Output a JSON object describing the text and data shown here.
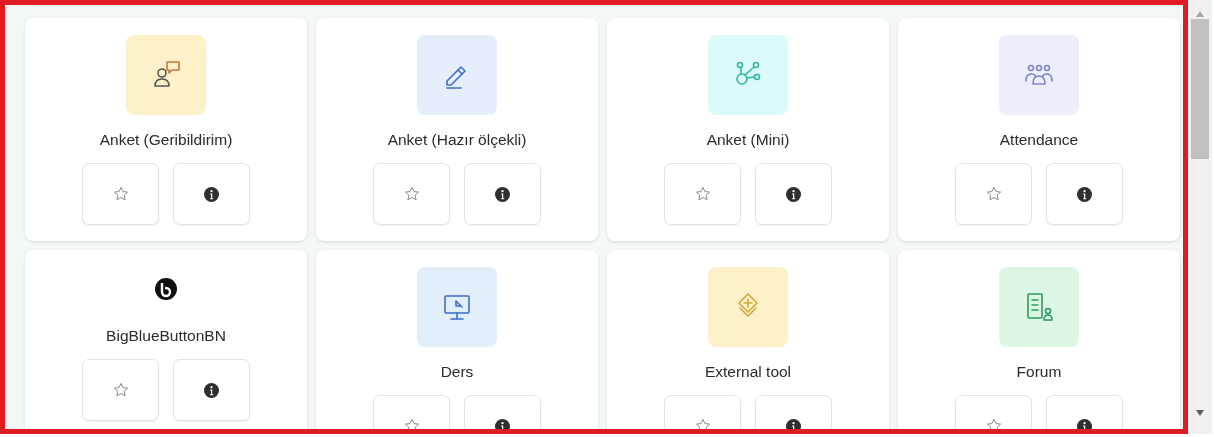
{
  "modules": [
    {
      "name": "Anket (Geribildirim)",
      "color": "#fdf1c9",
      "starred": false
    },
    {
      "name": "Anket (Hazır ölçekli)",
      "color": "#e6eefb",
      "starred": false
    },
    {
      "name": "Anket (Mini)",
      "color": "#dcfbf8",
      "starred": false
    },
    {
      "name": "Attendance",
      "color": "#eceefb",
      "starred": false
    },
    {
      "name": "BigBlueButtonBN",
      "starred": false
    },
    {
      "name": "Ders",
      "color": "#e3eefb",
      "starred": false
    },
    {
      "name": "External tool",
      "color": "#fdf1c9",
      "starred": false
    },
    {
      "name": "Forum",
      "color": "#dcf7e6",
      "starred": false
    }
  ]
}
